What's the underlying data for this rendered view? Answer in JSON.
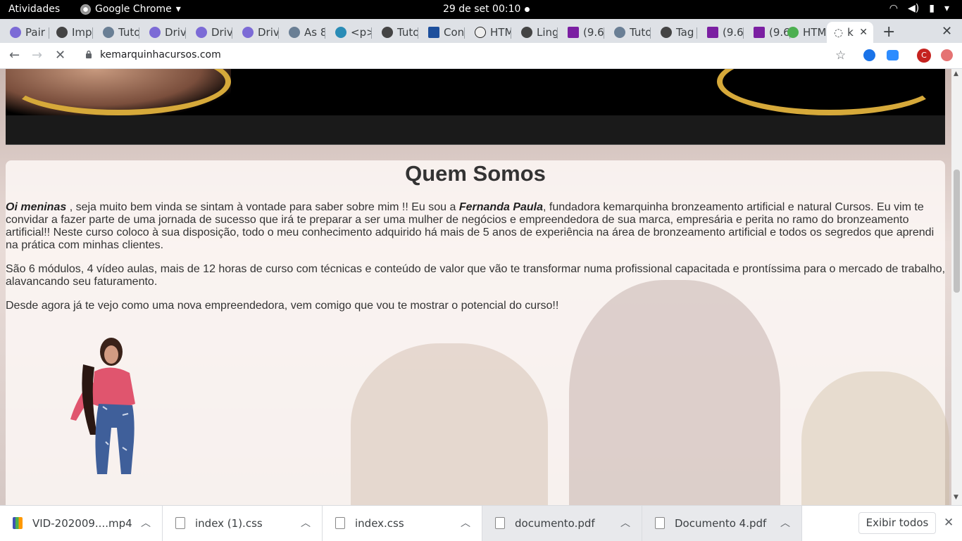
{
  "topbar": {
    "activities": "Atividades",
    "app_name": "Google Chrome",
    "clock": "29 de set  00:10"
  },
  "tabs": [
    {
      "label": "Pair",
      "color": "#7c6bd6"
    },
    {
      "label": "Imp",
      "color": "#444"
    },
    {
      "label": "Tuto",
      "color": "#6a7f95"
    },
    {
      "label": "Driv",
      "color": "#7c6bd6"
    },
    {
      "label": "Driv",
      "color": "#7c6bd6"
    },
    {
      "label": "Driv",
      "color": "#7c6bd6"
    },
    {
      "label": "As 8",
      "color": "#6a7f95"
    },
    {
      "label": "<p>",
      "color": "#2a8cb6"
    },
    {
      "label": "Tuto",
      "color": "#444"
    },
    {
      "label": "Con",
      "color": "#1d4f9c"
    },
    {
      "label": "HTM",
      "color": "#222"
    },
    {
      "label": "Ling",
      "color": "#444"
    },
    {
      "label": "(9.6",
      "color": "#7b1fa2"
    },
    {
      "label": "Tuto",
      "color": "#6a7f95"
    },
    {
      "label": "Tag",
      "color": "#444"
    },
    {
      "label": "(9.6",
      "color": "#7b1fa2"
    },
    {
      "label": "(9.6",
      "color": "#7b1fa2"
    },
    {
      "label": "HTM",
      "color": "#4caf50"
    },
    {
      "label": "k",
      "color": "#444"
    }
  ],
  "toolbar": {
    "url": "kemarquinhacursos.com"
  },
  "page": {
    "title": "Quem Somos",
    "p1_lead": "Oi meninas",
    "p1_a": " , seja muito bem vinda se sintam à vontade para saber sobre mim !! Eu sou a ",
    "p1_name": "Fernanda Paula",
    "p1_b": ", fundadora kemarquinha bronzeamento artificial e natural Cursos. Eu vim te convidar a fazer parte de uma jornada de sucesso que irá te preparar a ser uma mulher de negócios e empreendedora de sua marca, empresária e perita no ramo do bronzeamento artificial!! Neste curso coloco à sua disposição, todo o meu conhecimento adquirido há mais de 5 anos de experiência na área de bronzeamento artificial e todos os segredos que aprendi na prática com minhas clientes.",
    "p2": "São 6 módulos, 4 vídeo aulas, mais de 12 horas de curso com técnicas e conteúdo de valor que vão te transformar numa profissional capacitada e prontíssima para o mercado de trabalho, alavancando seu faturamento.",
    "p3": "Desde agora já te vejo como uma nova empreendedora, vem comigo que vou te mostrar o potencial do curso!!"
  },
  "downloads": [
    {
      "name": "VID-202009....mp4"
    },
    {
      "name": "index (1).css"
    },
    {
      "name": "index.css"
    },
    {
      "name": "documento.pdf"
    },
    {
      "name": "Documento 4.pdf"
    }
  ],
  "downloads_show_all": "Exibir todos"
}
